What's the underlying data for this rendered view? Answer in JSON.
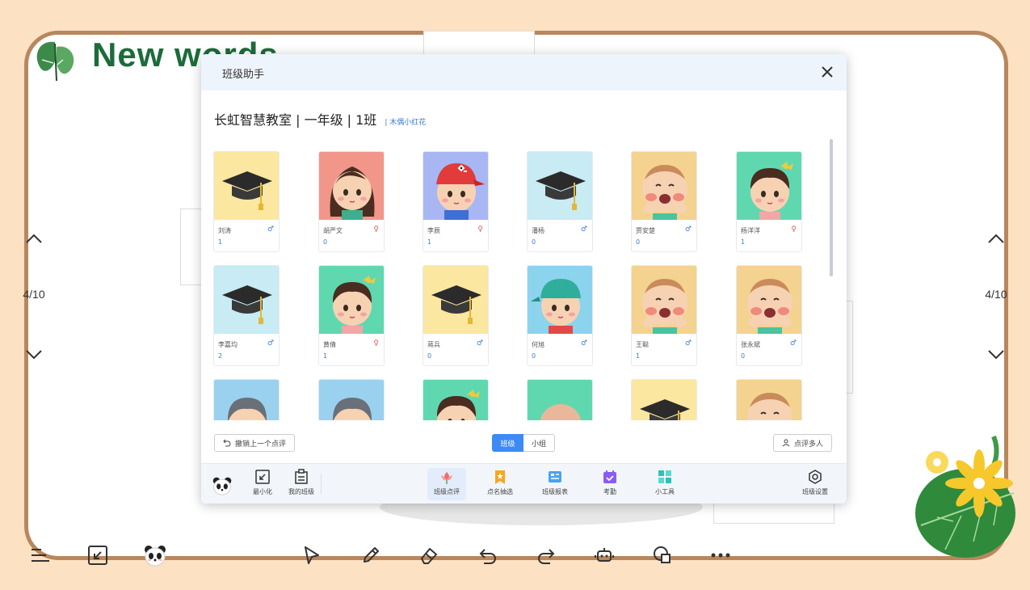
{
  "slide": {
    "title": "New words",
    "page_left": "4/10",
    "page_right": "4/10"
  },
  "dialog": {
    "title": "班级助手",
    "class_name": "长虹智慧教室 | 一年级 | 1班",
    "class_tag": "| 木偶小红花",
    "students": [
      {
        "name": "刘涛",
        "points": "1",
        "gender": "male",
        "avatar": "graduation-cap",
        "bg": "#fbe7a0"
      },
      {
        "name": "胡严文",
        "points": "0",
        "gender": "female",
        "avatar": "girl-long-hair",
        "bg": "#f3968a"
      },
      {
        "name": "李辰",
        "points": "1",
        "gender": "female",
        "avatar": "girl-red-cap",
        "bg": "#a9b6f4"
      },
      {
        "name": "潘杨",
        "points": "0",
        "gender": "male",
        "avatar": "graduation-cap",
        "bg": "#c8ebf4"
      },
      {
        "name": "贾安楚",
        "points": "0",
        "gender": "male",
        "avatar": "crying-kid",
        "bg": "#f4d28f"
      },
      {
        "name": "杨洋洋",
        "points": "1",
        "gender": "female",
        "avatar": "girl-bow",
        "bg": "#5fd8b0"
      },
      {
        "name": "李嘉均",
        "points": "2",
        "gender": "male",
        "avatar": "graduation-cap",
        "bg": "#c8ebf4"
      },
      {
        "name": "黄倩",
        "points": "1",
        "gender": "female",
        "avatar": "girl-bow",
        "bg": "#5fd8b0"
      },
      {
        "name": "蒋兵",
        "points": "0",
        "gender": "male",
        "avatar": "graduation-cap",
        "bg": "#fbe7a0"
      },
      {
        "name": "何旭",
        "points": "0",
        "gender": "male",
        "avatar": "boy-cap",
        "bg": "#8cd3ee"
      },
      {
        "name": "王聪",
        "points": "1",
        "gender": "male",
        "avatar": "crying-kid",
        "bg": "#f4d28f"
      },
      {
        "name": "张永斌",
        "points": "0",
        "gender": "male",
        "avatar": "crying-kid",
        "bg": "#f4d28f"
      },
      {
        "name": "",
        "points": "",
        "gender": "",
        "avatar": "boy-gray",
        "bg": "#9ad1ee"
      },
      {
        "name": "",
        "points": "",
        "gender": "",
        "avatar": "boy-gray",
        "bg": "#9ad1ee"
      },
      {
        "name": "",
        "points": "",
        "gender": "",
        "avatar": "girl-bow",
        "bg": "#5fd8b0"
      },
      {
        "name": "",
        "points": "",
        "gender": "",
        "avatar": "bald-kid",
        "bg": "#5fd8b0"
      },
      {
        "name": "",
        "points": "",
        "gender": "",
        "avatar": "graduation-cap",
        "bg": "#fbe7a0"
      },
      {
        "name": "",
        "points": "",
        "gender": "",
        "avatar": "crying-kid",
        "bg": "#f4d28f"
      }
    ],
    "undo_label": "撤销上一个点评",
    "seg_class": "班级",
    "seg_group": "小组",
    "multi_label": "点评多人",
    "footer": {
      "minimize": "最小化",
      "my_class": "我的班级",
      "class_review": "班级点评",
      "random_pick": "点名抽选",
      "class_report": "班级报表",
      "attendance": "考勤",
      "tools": "小工具",
      "settings": "班级设置"
    }
  },
  "colors": {
    "accent": "#3d8af7",
    "slide_border": "#b8875d",
    "title_green": "#1d6b3a",
    "background": "#fde1c3"
  }
}
